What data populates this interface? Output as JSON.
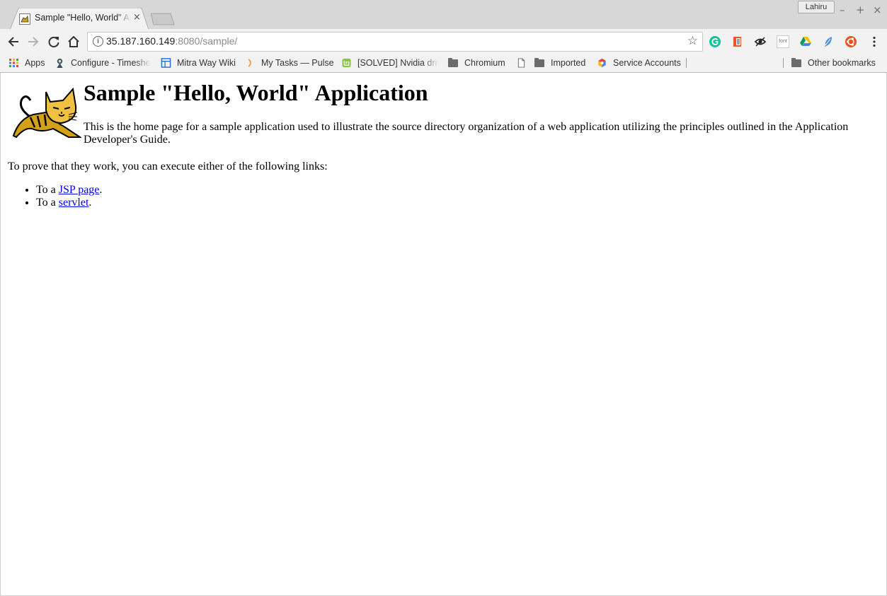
{
  "window": {
    "profile_name": "Lahiru",
    "minimize_glyph": "–",
    "maximize_glyph": "+",
    "close_glyph": "×"
  },
  "tab": {
    "title": "Sample \"Hello, World\" Application",
    "close_glyph": "×"
  },
  "address_bar": {
    "url_host": "35.187.160.149",
    "url_rest": ":8080/sample/",
    "info_glyph": "i",
    "star_glyph": "☆"
  },
  "extensions": [
    "grammarly-icon",
    "office-icon",
    "extension-eye-icon",
    "font-extension-icon",
    "google-drive-icon",
    "feather-icon",
    "ubuntu-icon"
  ],
  "extension_font_label": "font",
  "bookmarks": [
    {
      "label": "Apps",
      "icon": "apps-grid-icon"
    },
    {
      "label": "Configure - Timesheets",
      "icon": "jenkins-icon"
    },
    {
      "label": "Mitra Way Wiki",
      "icon": "wiki-icon"
    },
    {
      "label": "My Tasks — Pulse",
      "icon": "pulse-icon"
    },
    {
      "label": "[SOLVED] Nvidia drivers",
      "icon": "mint-icon"
    },
    {
      "label": "Chromium",
      "icon": "folder-icon"
    },
    {
      "label": "",
      "icon": "page-icon"
    },
    {
      "label": "Imported",
      "icon": "folder-icon"
    },
    {
      "label": "Service Accounts",
      "icon": "google-cloud-icon"
    },
    {
      "label": "Other bookmarks",
      "icon": "folder-icon"
    }
  ],
  "page": {
    "heading": "Sample \"Hello, World\" Application",
    "intro": "This is the home page for a sample application used to illustrate the source directory organization of a web application utilizing the principles outlined in the Application Developer's Guide.",
    "prove_text": "To prove that they work, you can execute either of the following links:",
    "links": [
      {
        "prefix": "To a ",
        "label": "JSP page",
        "suffix": "."
      },
      {
        "prefix": "To a ",
        "label": "servlet",
        "suffix": "."
      }
    ]
  },
  "colors": {
    "link": "#0000ee",
    "chrome_bg": "#f2f2f2",
    "titlebar_bg": "#d7d7d7"
  }
}
